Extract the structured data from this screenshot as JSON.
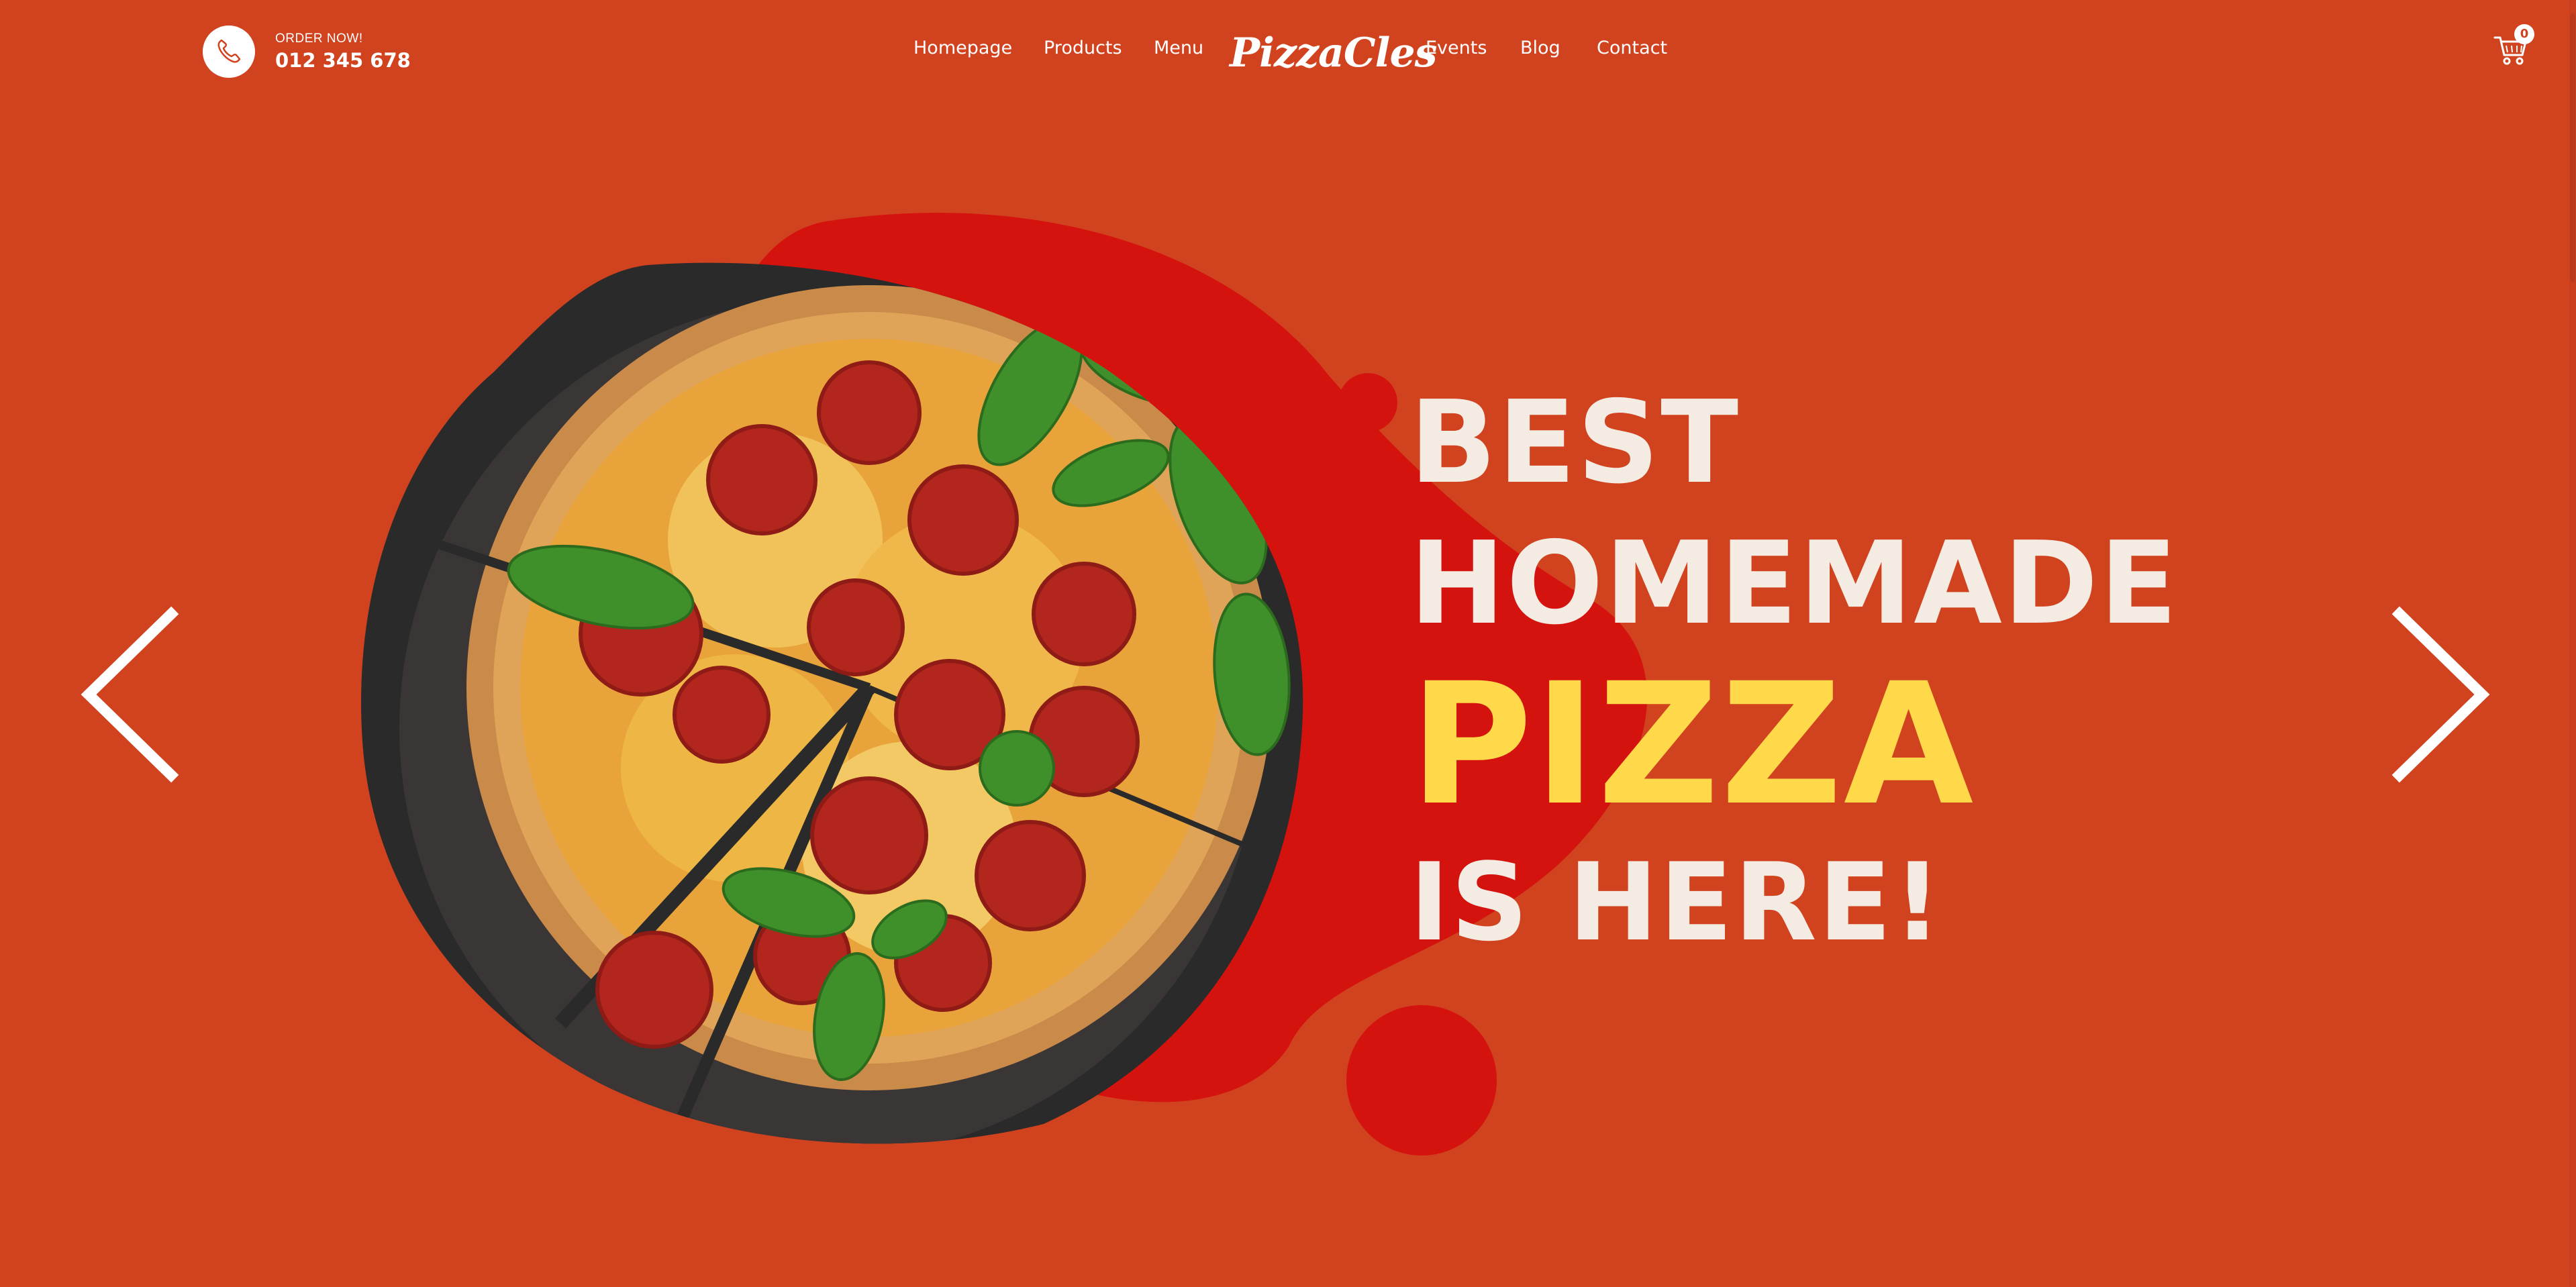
{
  "colors": {
    "background": "#d1421f",
    "blob": "#d4130f",
    "headline_light": "#f4ebe3",
    "headline_accent": "#ffd94a"
  },
  "header": {
    "order_label": "ORDER NOW!",
    "phone": "012 345 678",
    "phone_icon": "phone-icon",
    "logo": "PizzaCles",
    "nav": {
      "homepage": "Homepage",
      "products": "Products",
      "menu": "Menu",
      "events": "Events",
      "blog": "Blog",
      "contact": "Contact"
    },
    "cart_icon": "cart-icon",
    "cart_count": "0"
  },
  "hero": {
    "line1": "BEST",
    "line2": "HOMEMADE",
    "line3": "PIZZA",
    "line4": "IS HERE!",
    "image": "pepperoni-pizza-with-basil",
    "prev_icon": "chevron-left-icon",
    "next_icon": "chevron-right-icon"
  }
}
